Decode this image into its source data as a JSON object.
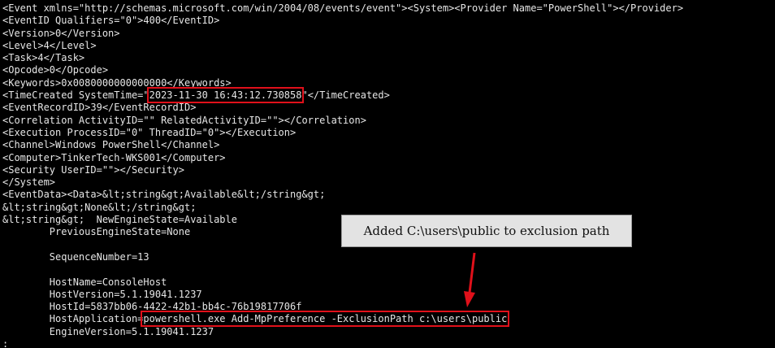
{
  "terminal": {
    "lines": [
      "<Event xmlns=\"http://schemas.microsoft.com/win/2004/08/events/event\"><System><Provider Name=\"PowerShell\"></Provider>",
      "<EventID Qualifiers=\"0\">400</EventID>",
      "<Version>0</Version>",
      "<Level>4</Level>",
      "<Task>4</Task>",
      "<Opcode>0</Opcode>",
      "<Keywords>0x0080000000000000</Keywords>",
      "",
      "<EventRecordID>39</EventRecordID>",
      "<Correlation ActivityID=\"\" RelatedActivityID=\"\"></Correlation>",
      "<Execution ProcessID=\"0\" ThreadID=\"0\"></Execution>",
      "<Channel>Windows PowerShell</Channel>",
      "<Computer>TinkerTech-WKS001</Computer>",
      "<Security UserID=\"\"></Security>",
      "</System>",
      "<EventData><Data>&lt;string&gt;Available&lt;/string&gt;",
      "&lt;string&gt;None&lt;/string&gt;",
      "&lt;string&gt;  NewEngineState=Available",
      "        PreviousEngineState=None",
      "",
      "        SequenceNumber=13",
      "",
      "        HostName=ConsoleHost",
      "        HostVersion=5.1.19041.1237",
      "        HostId=5837bb06-4422-42b1-bb4c-76b19817706f",
      "",
      "        EngineVersion=5.1.19041.1237",
      ":"
    ],
    "time_created": {
      "prefix": "<TimeCreated SystemTime=\"",
      "value": "2023-11-30 16:43:12.730858",
      "suffix": "\"</TimeCreated>"
    },
    "host_application": {
      "prefix": "        HostApplication=",
      "value": "powershell.exe Add-MpPreference -ExclusionPath c:\\users\\public"
    }
  },
  "annotation": {
    "callout_text": "Added C:\\users\\public to exclusion path",
    "highlight_color": "#e0101a"
  }
}
